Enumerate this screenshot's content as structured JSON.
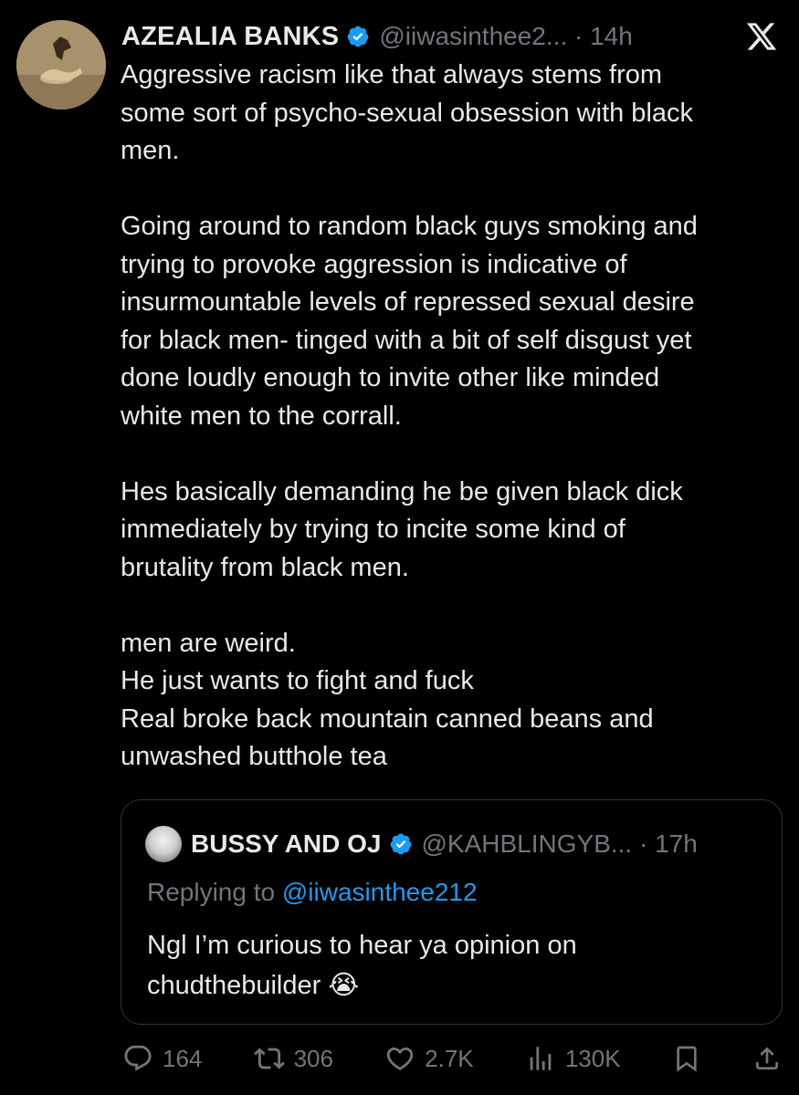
{
  "tweet": {
    "author_name": "AZEALIA BANKS",
    "handle_time": "@iiwasinthee2... · 14h",
    "paragraphs": [
      [
        "Aggressive racism like that always stems from",
        "some sort of psycho-sexual obsession with black",
        "men."
      ],
      [
        "Going around to random black guys smoking and",
        "trying to provoke aggression is indicative of",
        "insurmountable levels of repressed sexual desire",
        "for black men-  tinged with a bit of self disgust yet",
        "done loudly enough to invite other like minded",
        "white men to the corrall."
      ],
      [
        "Hes basically demanding he be given black dick",
        "immediately by trying to incite some kind of",
        "brutality from black men."
      ],
      [
        "men are weird.",
        "He just wants to fight and fuck",
        "Real broke back mountain canned beans and",
        "unwashed butthole tea"
      ]
    ]
  },
  "quote": {
    "author_name": "BUSSY AND OJ",
    "handle_time": "@KAHBLINGYB... · 17h",
    "replying_prefix": "Replying to ",
    "replying_to": "@iiwasinthee212",
    "text_line1": "Ngl I’m curious to hear ya opinion on",
    "text_line2": "chudthebuilder 😭"
  },
  "actions": {
    "replies": "164",
    "reposts": "306",
    "likes": "2.7K",
    "views": "130K"
  },
  "colors": {
    "background": "#000000",
    "text": "#e7e9ea",
    "muted": "#71767b",
    "accent": "#1d9bf0",
    "border": "#2f3336"
  },
  "icons": [
    "verified-badge-icon",
    "x-logo-icon",
    "reply-icon",
    "repost-icon",
    "like-icon",
    "views-icon",
    "bookmark-icon",
    "share-icon"
  ]
}
